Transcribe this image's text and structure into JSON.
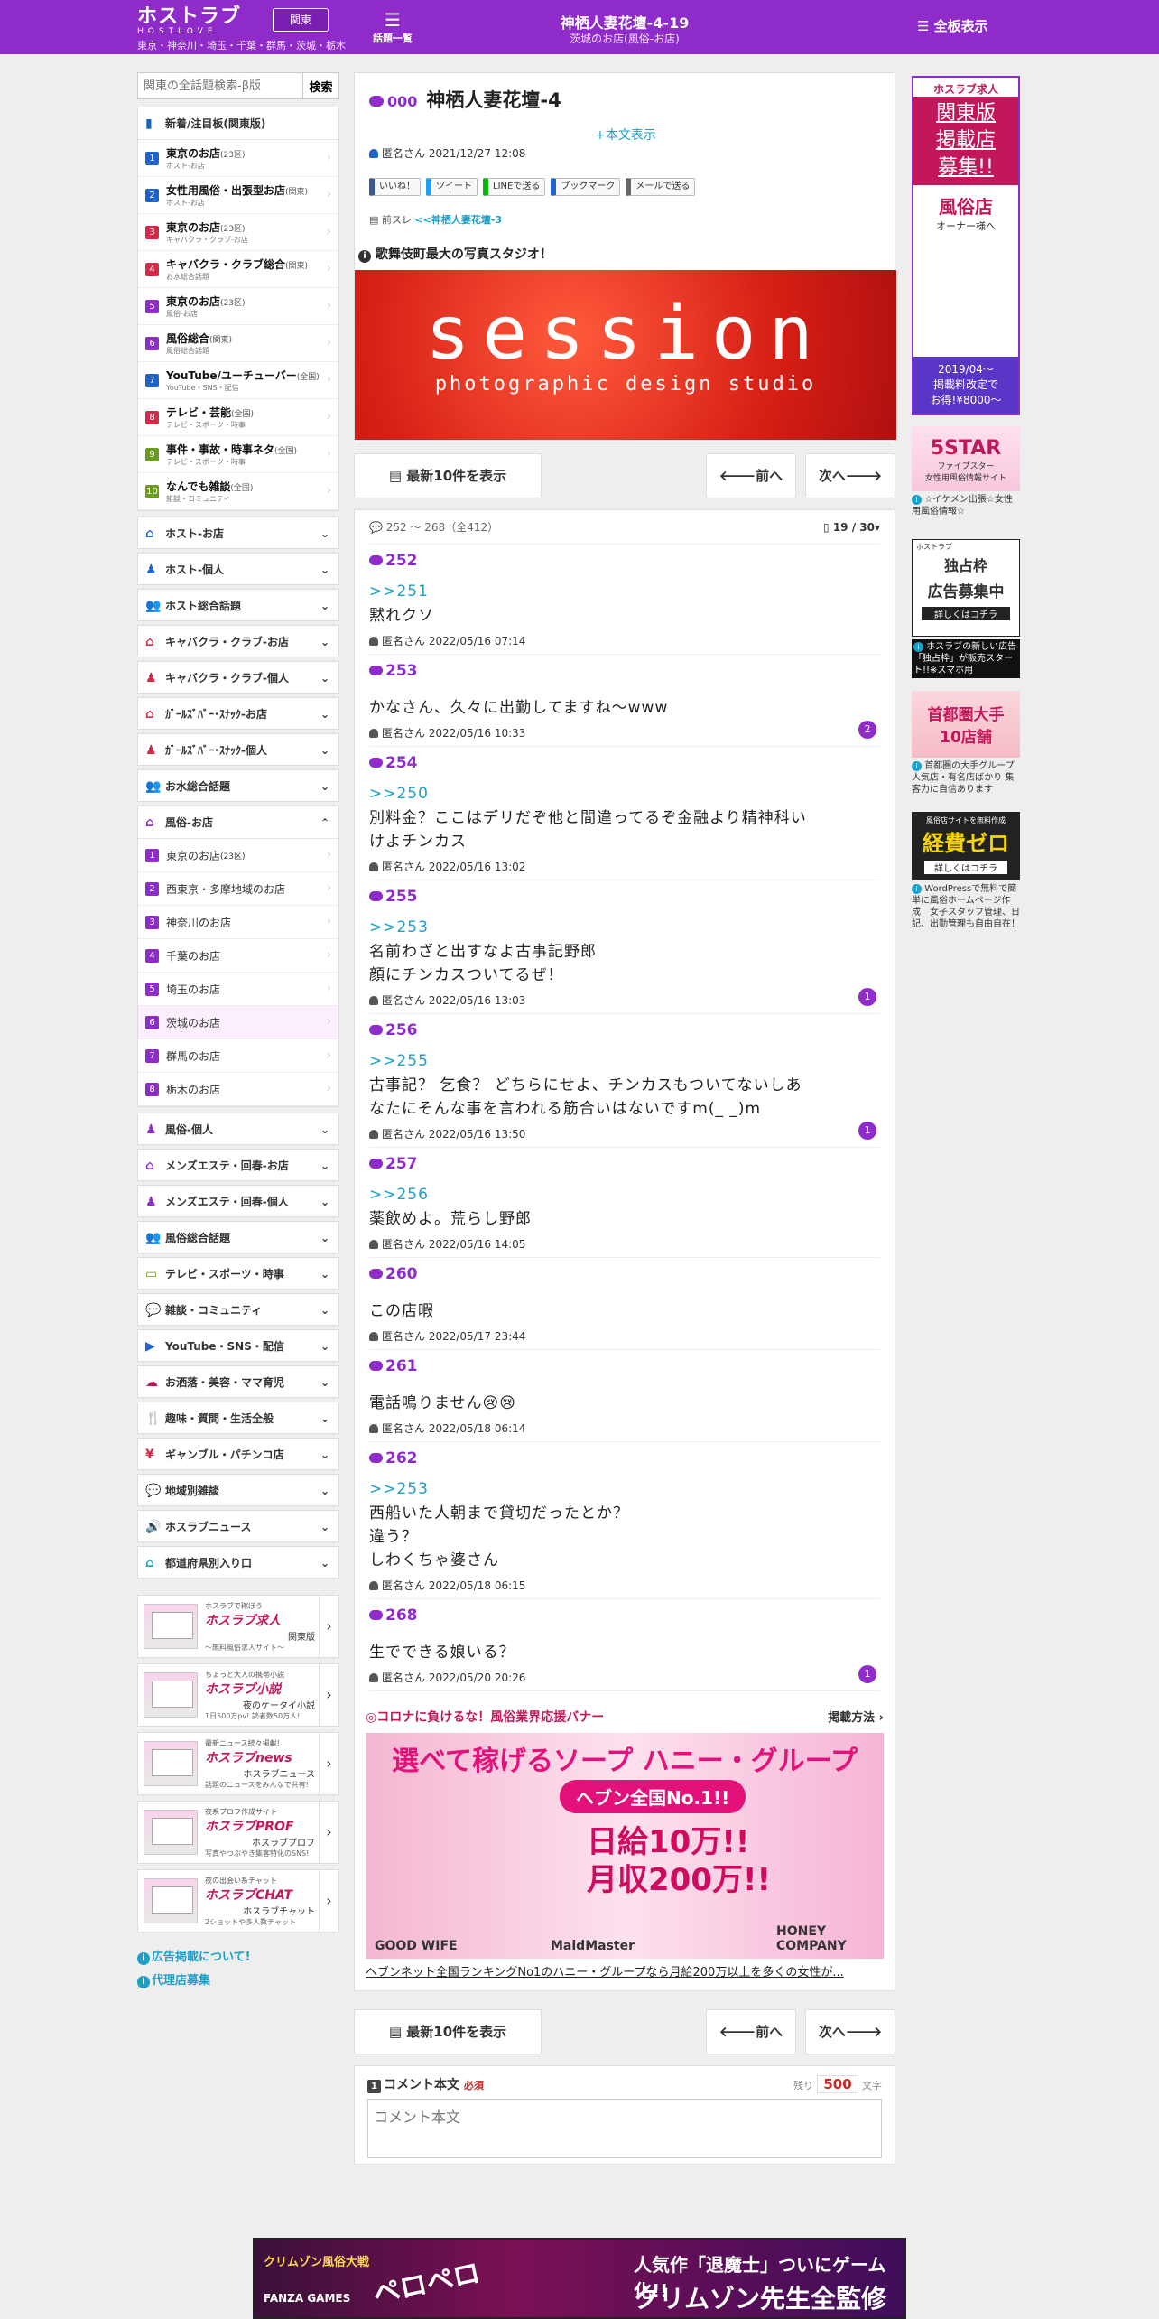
{
  "header": {
    "logo_main": "ホストラブ",
    "logo_sub": "HOSTLOVE",
    "region_button": "関東",
    "regions": "東京・神奈川・埼玉・千葉・群馬・茨城・栃木",
    "topic_list_label": "話題一覧",
    "title": "神栖人妻花壇-4-19",
    "subtitle": "茨城のお店(風俗-お店)",
    "all_boards_label": "全板表示"
  },
  "sidebar": {
    "search_placeholder": "関東の全話題検索-β版",
    "search_button": "検索",
    "new_heading": "新着/注目板(関東版)",
    "ranked_items": [
      {
        "n": "1",
        "color": "#1e63c7",
        "title": "東京のお店",
        "scope": "(23区)",
        "sub": "ホスト-お店"
      },
      {
        "n": "2",
        "color": "#1e63c7",
        "title": "女性用風俗・出張型お店",
        "scope": "(関東)",
        "sub": "ホスト-お店"
      },
      {
        "n": "3",
        "color": "#d42a4a",
        "title": "東京のお店",
        "scope": "(23区)",
        "sub": "キャバクラ・クラブ-お店"
      },
      {
        "n": "4",
        "color": "#d42a4a",
        "title": "キャバクラ・クラブ総合",
        "scope": "(関東)",
        "sub": "お水総合話題"
      },
      {
        "n": "5",
        "color": "#8e2bc9",
        "title": "東京のお店",
        "scope": "(23区)",
        "sub": "風俗-お店"
      },
      {
        "n": "6",
        "color": "#8e2bc9",
        "title": "風俗総合",
        "scope": "(関東)",
        "sub": "風俗総合話題"
      },
      {
        "n": "7",
        "color": "#1e63c7",
        "title": "YouTube/ユーチューバー",
        "scope": "(全国)",
        "sub": "YouTube・SNS・配信"
      },
      {
        "n": "8",
        "color": "#d42a4a",
        "title": "テレビ・芸能",
        "scope": "(全国)",
        "sub": "テレビ・スポーツ・時事"
      },
      {
        "n": "9",
        "color": "#6a9a1f",
        "title": "事件・事故・時事ネタ",
        "scope": "(全国)",
        "sub": "テレビ・スポーツ・時事"
      },
      {
        "n": "10",
        "color": "#6a9a1f",
        "title": "なんでも雑談",
        "scope": "(全国)",
        "sub": "雑談・コミュニティ"
      }
    ],
    "categories_top": [
      {
        "label": "ホスト-お店",
        "icon": "house-icon",
        "color": "#1e63c7"
      },
      {
        "label": "ホスト-個人",
        "icon": "person-icon",
        "color": "#1e63c7"
      },
      {
        "label": "ホスト総合話題",
        "icon": "group-icon",
        "color": "#1e63c7"
      },
      {
        "label": "キャバクラ・クラブ-お店",
        "icon": "house-icon",
        "color": "#d42a4a"
      },
      {
        "label": "キャバクラ・クラブ-個人",
        "icon": "person-icon",
        "color": "#d42a4a"
      },
      {
        "label": "ｶﾞｰﾙｽﾞﾊﾞｰ･ｽﾅｯｸ-お店",
        "icon": "house-icon",
        "color": "#d42a4a"
      },
      {
        "label": "ｶﾞｰﾙｽﾞﾊﾞｰ･ｽﾅｯｸ-個人",
        "icon": "person-icon",
        "color": "#d42a4a"
      },
      {
        "label": "お水総合話題",
        "icon": "group-icon",
        "color": "#d42a4a"
      }
    ],
    "fuzoku_heading": "風俗-お店",
    "fuzoku_items": [
      {
        "n": "1",
        "label": "東京のお店",
        "scope": "(23区)"
      },
      {
        "n": "2",
        "label": "西東京・多摩地域のお店",
        "scope": ""
      },
      {
        "n": "3",
        "label": "神奈川のお店",
        "scope": ""
      },
      {
        "n": "4",
        "label": "千葉のお店",
        "scope": ""
      },
      {
        "n": "5",
        "label": "埼玉のお店",
        "scope": ""
      },
      {
        "n": "6",
        "label": "茨城のお店",
        "scope": ""
      },
      {
        "n": "7",
        "label": "群馬のお店",
        "scope": ""
      },
      {
        "n": "8",
        "label": "栃木のお店",
        "scope": ""
      }
    ],
    "categories_bottom": [
      {
        "label": "風俗-個人",
        "icon": "person-icon",
        "color": "#8e2bc9"
      },
      {
        "label": "メンズエステ・回春-お店",
        "icon": "house-icon",
        "color": "#8e2bc9"
      },
      {
        "label": "メンズエステ・回春-個人",
        "icon": "person-icon",
        "color": "#8e2bc9"
      },
      {
        "label": "風俗総合話題",
        "icon": "group-icon",
        "color": "#8e2bc9"
      },
      {
        "label": "テレビ・スポーツ・時事",
        "icon": "tv-icon",
        "color": "#6a9a1f"
      },
      {
        "label": "雑談・コミュニティ",
        "icon": "chat-icon",
        "color": "#2e9d4a"
      },
      {
        "label": "YouTube・SNS・配信",
        "icon": "youtube-icon",
        "color": "#1e63c7"
      },
      {
        "label": "お洒落・美容・ママ育児",
        "icon": "cloud-icon",
        "color": "#c2185b"
      },
      {
        "label": "趣味・質問・生活全般",
        "icon": "fork-icon",
        "color": "#d42a4a"
      },
      {
        "label": "ギャンブル・パチンコ店",
        "icon": "yen-icon",
        "color": "#d42a4a"
      },
      {
        "label": "地域別雑談",
        "icon": "chat-icon",
        "color": "#1ca0c8"
      },
      {
        "label": "ホスラブニュース",
        "icon": "speaker-icon",
        "color": "#333333"
      },
      {
        "label": "都道府県別入り口",
        "icon": "house-icon",
        "color": "#1ca0c8"
      }
    ],
    "promos": [
      {
        "top": "ホスラブで稼ぼう",
        "name": "ホスラブ求人",
        "tag": "関東版",
        "desc": "〜無料風俗求人サイト〜"
      },
      {
        "top": "ちょっと大人の携帯小説",
        "name": "ホスラブ小説",
        "tag": "夜のケータイ小説",
        "desc": "1日500万pv! 読者数50万人!"
      },
      {
        "top": "最新ニュース続々掲載!",
        "name": "ホスラブnews",
        "tag": "ホスラブニュース",
        "desc": "話題のニュースをみんなで共有!"
      },
      {
        "top": "夜系プロフ作成サイト",
        "name": "ホスラブPROF",
        "tag": "ホスラブプロフ",
        "desc": "写真やつぶやき集客特化のSNS!"
      },
      {
        "top": "夜の出会い系チャット",
        "name": "ホスラブCHAT",
        "tag": "ホスラブチャット",
        "desc": "2ショットや多人数チャット"
      }
    ],
    "links": [
      "広告掲載について!",
      "代理店募集"
    ]
  },
  "thread": {
    "number": "000",
    "title": "神栖人妻花壇-4",
    "show_body": "+本文表示",
    "author": "匿名さん",
    "date": "2021/12/27 12:08",
    "share_buttons": [
      "いいね！",
      "ツイート",
      "LINEで送る",
      "ブックマーク",
      "メールで送る"
    ],
    "prev_label": "前スレ",
    "prev_link": "<<神栖人妻花壇-3",
    "ad_title": "歌舞伎町最大の写真スタジオ！",
    "ad_banner_main": "session",
    "ad_banner_sub": "photographic design studio"
  },
  "pager": {
    "latest_label": "最新10件を表示",
    "prev_label": "前へ",
    "next_label": "次へ"
  },
  "posts_range": "252 〜 268（全412）",
  "page_indicator": "19 / 30",
  "posts": [
    {
      "num": "252",
      "anchor": ">>251",
      "body": [
        "黙れクソ"
      ],
      "author": "匿名さん",
      "date": "2022/05/16 07:14",
      "badge": ""
    },
    {
      "num": "253",
      "anchor": "",
      "body": [
        "かなさん、久々に出勤してますね～www"
      ],
      "author": "匿名さん",
      "date": "2022/05/16 10:33",
      "badge": "2"
    },
    {
      "num": "254",
      "anchor": ">>250",
      "body": [
        "別料金？ここはデリだぞ他と間違ってるぞ金融より精神科い",
        "けよチンカス"
      ],
      "author": "匿名さん",
      "date": "2022/05/16 13:02",
      "badge": ""
    },
    {
      "num": "255",
      "anchor": ">>253",
      "body": [
        "名前わざと出すなよ古事記野郎",
        "顔にチンカスついてるぜ！"
      ],
      "author": "匿名さん",
      "date": "2022/05/16 13:03",
      "badge": "1"
    },
    {
      "num": "256",
      "anchor": ">>255",
      "body": [
        "古事記？ 乞食？ どちらにせよ、チンカスもついてないしあ",
        "なたにそんな事を言われる筋合いはないですm(_ _)m"
      ],
      "author": "匿名さん",
      "date": "2022/05/16 13:50",
      "badge": "1"
    },
    {
      "num": "257",
      "anchor": ">>256",
      "body": [
        "薬飲めよ。荒らし野郎"
      ],
      "author": "匿名さん",
      "date": "2022/05/16 14:05",
      "badge": ""
    },
    {
      "num": "260",
      "anchor": "",
      "body": [
        "この店暇"
      ],
      "author": "匿名さん",
      "date": "2022/05/17 23:44",
      "badge": ""
    },
    {
      "num": "261",
      "anchor": "",
      "body": [
        "電話鳴りません😢😢"
      ],
      "author": "匿名さん",
      "date": "2022/05/18 06:14",
      "badge": ""
    },
    {
      "num": "262",
      "anchor": ">>253",
      "body": [
        "西船いた人朝まで貸切だったとか？",
        "違う？",
        "しわくちゃ婆さん"
      ],
      "author": "匿名さん",
      "date": "2022/05/18 06:15",
      "badge": ""
    },
    {
      "num": "268",
      "anchor": "",
      "body": [
        "生でできる娘いる？"
      ],
      "author": "匿名さん",
      "date": "2022/05/20 20:26",
      "badge": "1"
    }
  ],
  "banner_section": {
    "title": "◎コロナに負けるな！風俗業界応援バナー",
    "how_label": "掲載方法",
    "h1": "選べて稼げるソープ ハニー・グループ",
    "h2": "ヘブン全国No.1!!",
    "h3a": "日給10万!!",
    "h3b": "月収200万!!",
    "brands": [
      "GOOD WIFE",
      "MaidMaster",
      "HONEY COMPANY"
    ],
    "caption": "ヘブンネット全国ランキングNo1のハニー・グループなら月給200万以上を多くの女性が..."
  },
  "comment": {
    "number": "1",
    "label": "コメント本文",
    "required": "必須",
    "remaining_label": "残り",
    "remaining": "500",
    "unit": "文字",
    "placeholder": "コメント本文"
  },
  "right_ads": [
    {
      "lines": [
        "ホスラブ求人",
        "関東版",
        "掲載店",
        "募集!!",
        "風俗店",
        "オーナー様へ",
        "2019/04〜",
        "掲載料改定で",
        "お得!¥8000〜"
      ],
      "caption": ""
    },
    {
      "lines": [
        "5STAR",
        "ファイブスター",
        "女性用風俗情報サイト"
      ],
      "caption": "☆イケメン出張☆女性用風俗情報☆"
    },
    {
      "lines": [
        "ホストラブ",
        "独占枠",
        "広告募集中",
        "詳しくはコチラ"
      ],
      "caption": "ホスラブの新しい広告「独占枠」が販売スタート!!※スマホ用"
    },
    {
      "lines": [
        "首都圏大手",
        "10店舗"
      ],
      "caption": "首都圏の大手グループ 人気店・有名店ばかり 集客力に自信あります"
    },
    {
      "lines": [
        "風俗店サイトを無料作成",
        "経費ゼロ",
        "詳しくはコチラ"
      ],
      "caption": "WordPressで無料で簡単に風俗ホームページ作成！女子スタッフ管理、日記、出勤管理も自由自在！"
    }
  ],
  "footer_ad": {
    "brand": "クリムゾン風俗大戦",
    "maker": "FANZA GAMES",
    "sticker": "ペロペロ",
    "line1": "人気作「退魔士」ついにゲーム化!!",
    "line2": "クリムゾン先生全監修"
  }
}
